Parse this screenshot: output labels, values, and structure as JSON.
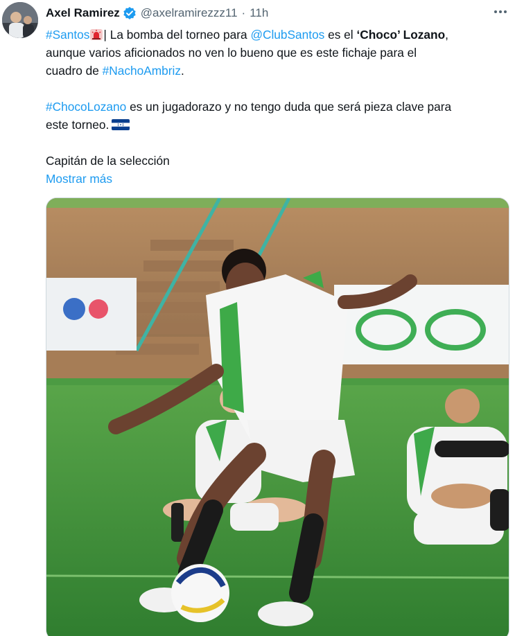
{
  "tweet": {
    "author_name": "Axel Ramirez",
    "handle": "@axelramirezzz11",
    "separator": "·",
    "time": "11h",
    "more_icon": "more-horizontal-icon",
    "verified_icon": "verified-badge-icon",
    "text": {
      "l1_tag": "#Santos",
      "l1_a": "| La bomba del torneo para ",
      "l1_mention": "@ClubSantos",
      "l1_b": " es el ",
      "l1_bold": "‘Choco’ Lozano",
      "l1_c": ",",
      "l2": "aunque varios aficionados no ven lo bueno que es este fichaje para el",
      "l3_a": "cuadro de ",
      "l3_tag": "#NachoAmbriz",
      "l3_b": ".",
      "l4_tag": "#ChocoLozano",
      "l4_a": " es un jugadorazo y no tengo duda que será pieza clave para",
      "l5": "este torneo.",
      "l6": "Capitán de la selección"
    },
    "show_more": "Mostrar más",
    "colors": {
      "link": "#1d9bf0",
      "text": "#0f1419",
      "secondary": "#536471"
    }
  }
}
